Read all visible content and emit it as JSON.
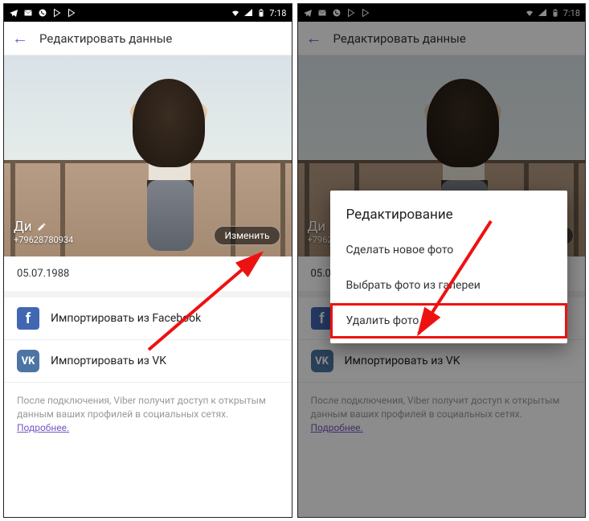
{
  "status": {
    "time": "7:18"
  },
  "appbar": {
    "title": "Редактировать данные"
  },
  "profile": {
    "name": "Ди",
    "phone": "+79628780934",
    "change_btn": "Изменить",
    "dob": "05.07.1988"
  },
  "imports": {
    "facebook": "Импортировать из Facebook",
    "vk": "Импортировать из VK"
  },
  "footer": {
    "text": "После подключения, Viber получит доступ к открытым данным ваших профилей в социальных сетях.",
    "more": "Подробнее."
  },
  "dialog": {
    "title": "Редактирование",
    "items": [
      "Сделать новое фото",
      "Выбрать фото из галереи",
      "Удалить фото"
    ]
  }
}
